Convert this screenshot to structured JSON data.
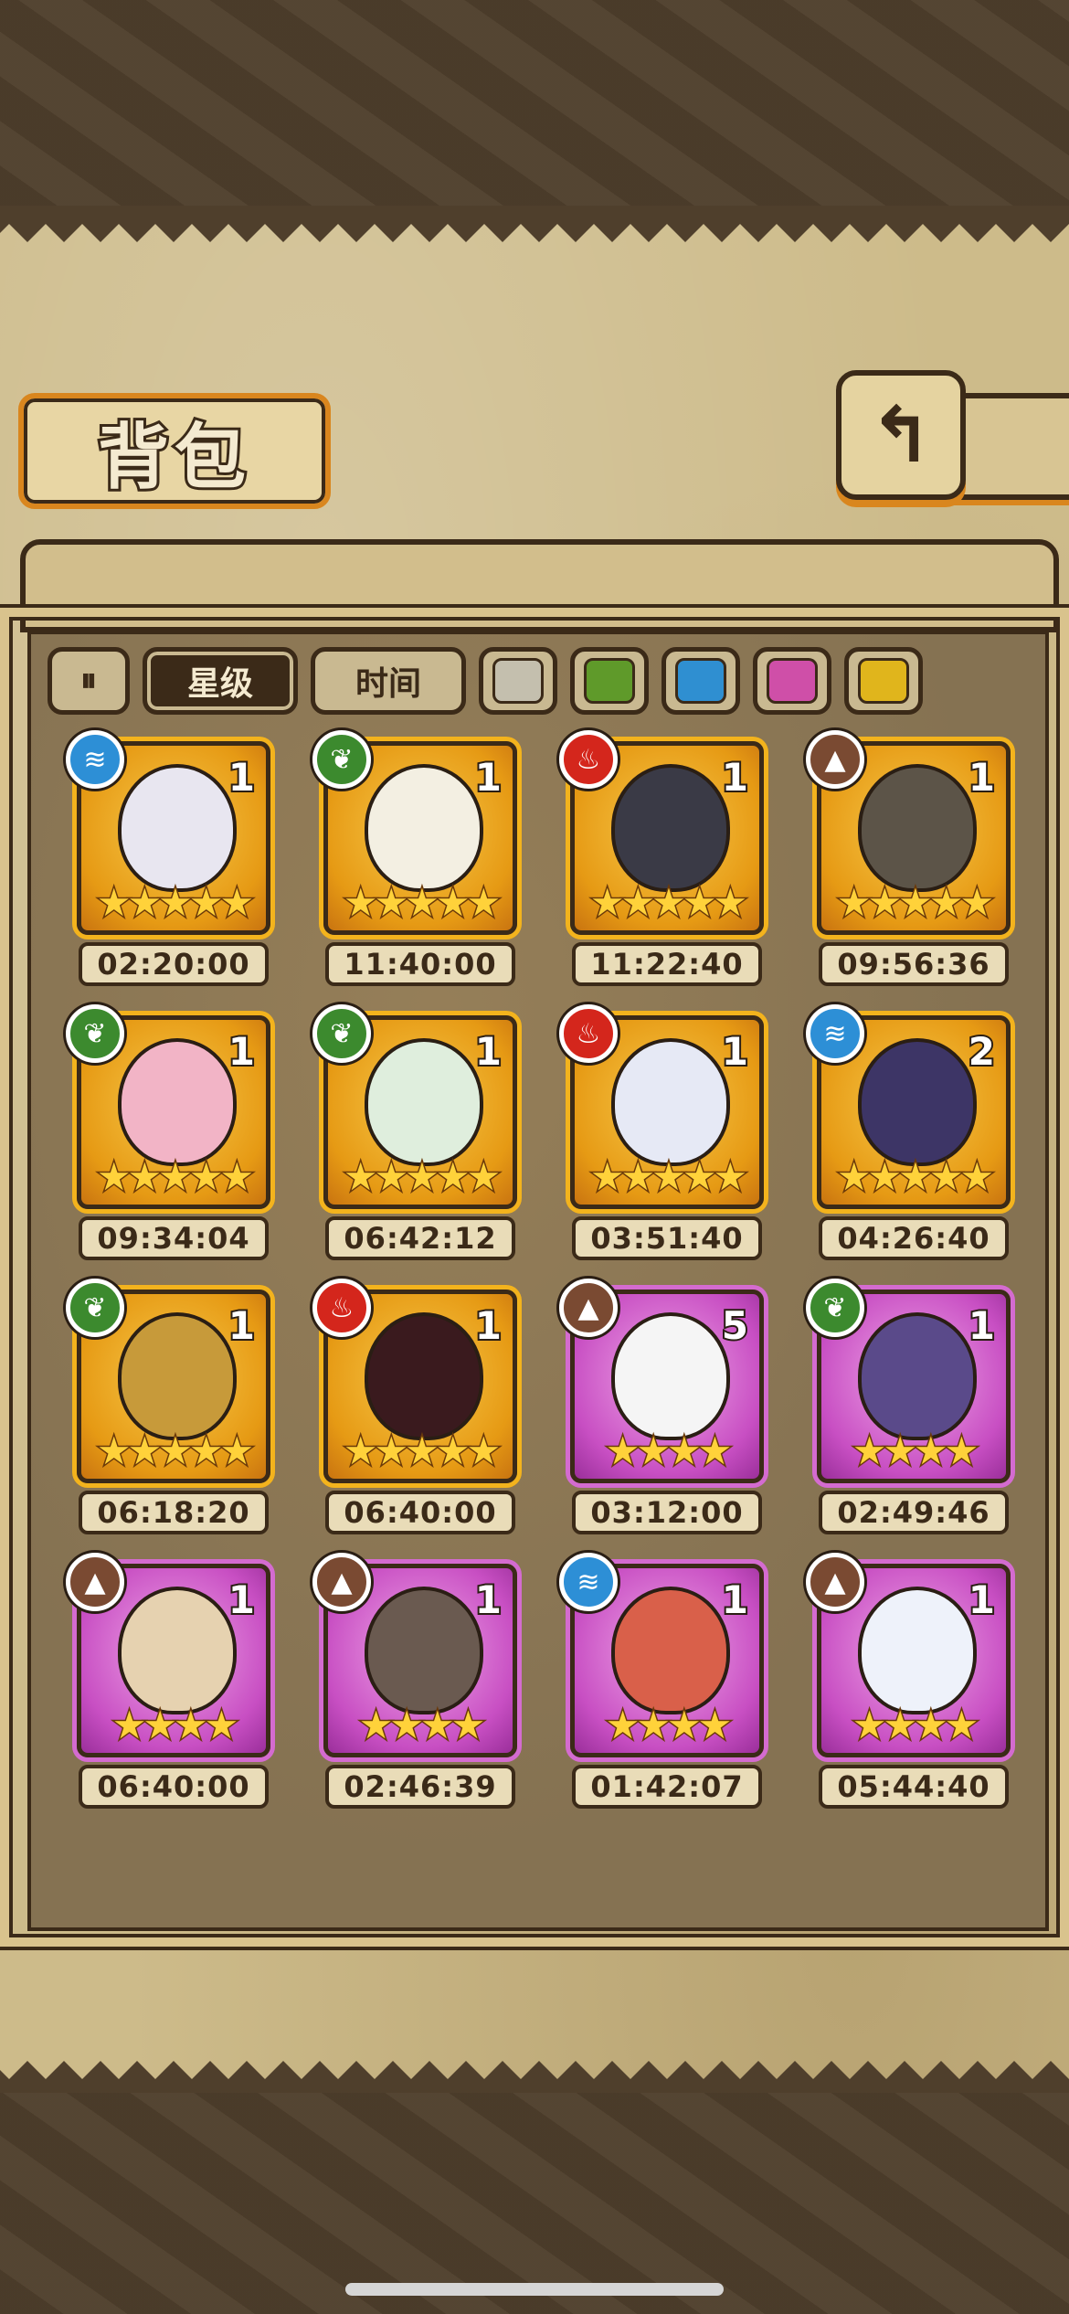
{
  "header": {
    "title": "背包",
    "back_icon": "↰"
  },
  "filters": {
    "toggle_icon": "⏸",
    "sort_options": [
      {
        "label": "星级",
        "active": true
      },
      {
        "label": "时间",
        "active": false
      }
    ],
    "colors": [
      "#c4bfae",
      "#5f9a2a",
      "#2f8fd1",
      "#cf4fa8",
      "#e0b51c"
    ]
  },
  "items": [
    {
      "element": "water",
      "rarity": "gold",
      "count": "1",
      "stars": "★★★★★",
      "timer": "02:20:00",
      "egg": "#e8e6f0"
    },
    {
      "element": "grass",
      "rarity": "gold",
      "count": "1",
      "stars": "★★★★★",
      "timer": "11:40:00",
      "egg": "#f3efe2"
    },
    {
      "element": "fire",
      "rarity": "gold",
      "count": "1",
      "stars": "★★★★★",
      "timer": "11:22:40",
      "egg": "#3a3a46"
    },
    {
      "element": "earth",
      "rarity": "gold",
      "count": "1",
      "stars": "★★★★★",
      "timer": "09:56:36",
      "egg": "#5c5448"
    },
    {
      "element": "grass",
      "rarity": "gold",
      "count": "1",
      "stars": "★★★★★",
      "timer": "09:34:04",
      "egg": "#f2b4c6"
    },
    {
      "element": "grass",
      "rarity": "gold",
      "count": "1",
      "stars": "★★★★★",
      "timer": "06:42:12",
      "egg": "#dfeedd"
    },
    {
      "element": "fire",
      "rarity": "gold",
      "count": "1",
      "stars": "★★★★★",
      "timer": "03:51:40",
      "egg": "#e6e9f5"
    },
    {
      "element": "water",
      "rarity": "gold",
      "count": "2",
      "stars": "★★★★★",
      "timer": "04:26:40",
      "egg": "#3d3566"
    },
    {
      "element": "grass",
      "rarity": "gold",
      "count": "1",
      "stars": "★★★★★",
      "timer": "06:18:20",
      "egg": "#c79a3a"
    },
    {
      "element": "fire",
      "rarity": "gold",
      "count": "1",
      "stars": "★★★★★",
      "timer": "06:40:00",
      "egg": "#3a1a1e"
    },
    {
      "element": "earth",
      "rarity": "purple",
      "count": "5",
      "stars": "★★★★",
      "timer": "03:12:00",
      "egg": "#f5f5f5"
    },
    {
      "element": "grass",
      "rarity": "purple",
      "count": "1",
      "stars": "★★★★",
      "timer": "02:49:46",
      "egg": "#5a4a8a"
    },
    {
      "element": "earth",
      "rarity": "purple",
      "count": "1",
      "stars": "★★★★",
      "timer": "06:40:00",
      "egg": "#e6d2b0"
    },
    {
      "element": "earth",
      "rarity": "purple",
      "count": "1",
      "stars": "★★★★",
      "timer": "02:46:39",
      "egg": "#6a5a50"
    },
    {
      "element": "water",
      "rarity": "purple",
      "count": "1",
      "stars": "★★★★",
      "timer": "01:42:07",
      "egg": "#d9604a"
    },
    {
      "element": "earth",
      "rarity": "purple",
      "count": "1",
      "stars": "★★★★",
      "timer": "05:44:40",
      "egg": "#eef2fa"
    }
  ],
  "element_icons": {
    "water": "≋",
    "grass": "❦",
    "fire": "♨",
    "earth": "▲"
  }
}
